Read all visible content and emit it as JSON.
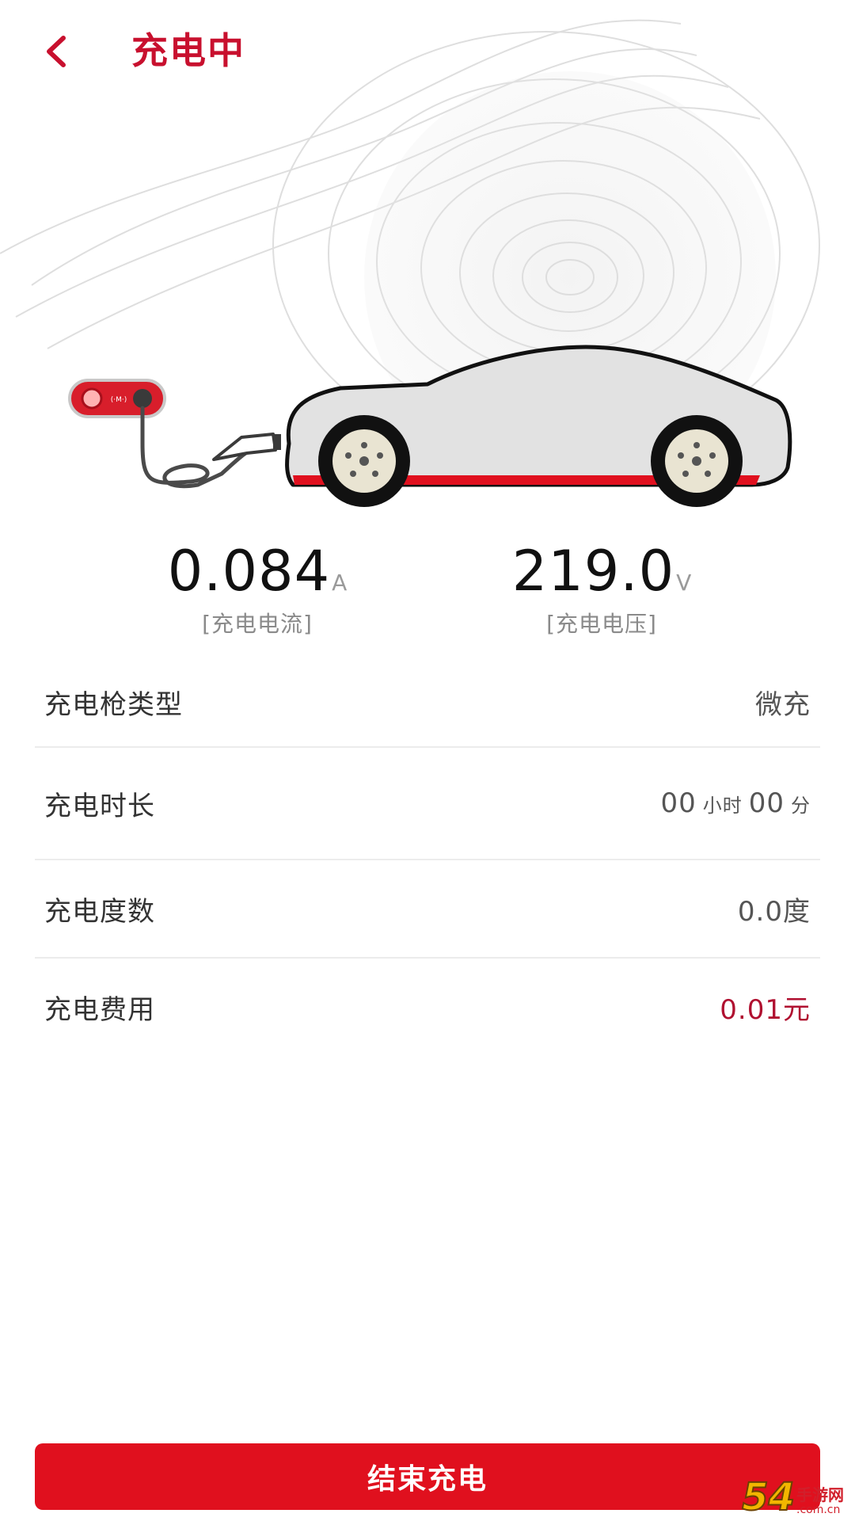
{
  "header": {
    "title": "充电中",
    "back_icon": "chevron-left-icon"
  },
  "hero": {
    "charger_icon": "wallbox-charger-icon",
    "car_icon": "car-icon",
    "accent_color": "#e0101e"
  },
  "readouts": {
    "current": {
      "value": "0.084",
      "unit": "A",
      "caption": "[充电电流]"
    },
    "voltage": {
      "value": "219.0",
      "unit": "V",
      "caption": "[充电电压]"
    }
  },
  "details": {
    "gun_type": {
      "label": "充电枪类型",
      "value": "微充"
    },
    "duration": {
      "label": "充电时长",
      "hours": "00",
      "hours_unit": "小时",
      "minutes": "00",
      "minutes_unit": "分"
    },
    "energy": {
      "label": "充电度数",
      "value": "0.0度"
    },
    "fee": {
      "label": "充电费用",
      "value": "0.01元",
      "color": "#b01030"
    }
  },
  "actions": {
    "end_label": "结束充电",
    "button_color": "#e0101e"
  },
  "watermark": {
    "big": "54",
    "site_name": "手游网",
    "site_domain": ".com.cn"
  }
}
